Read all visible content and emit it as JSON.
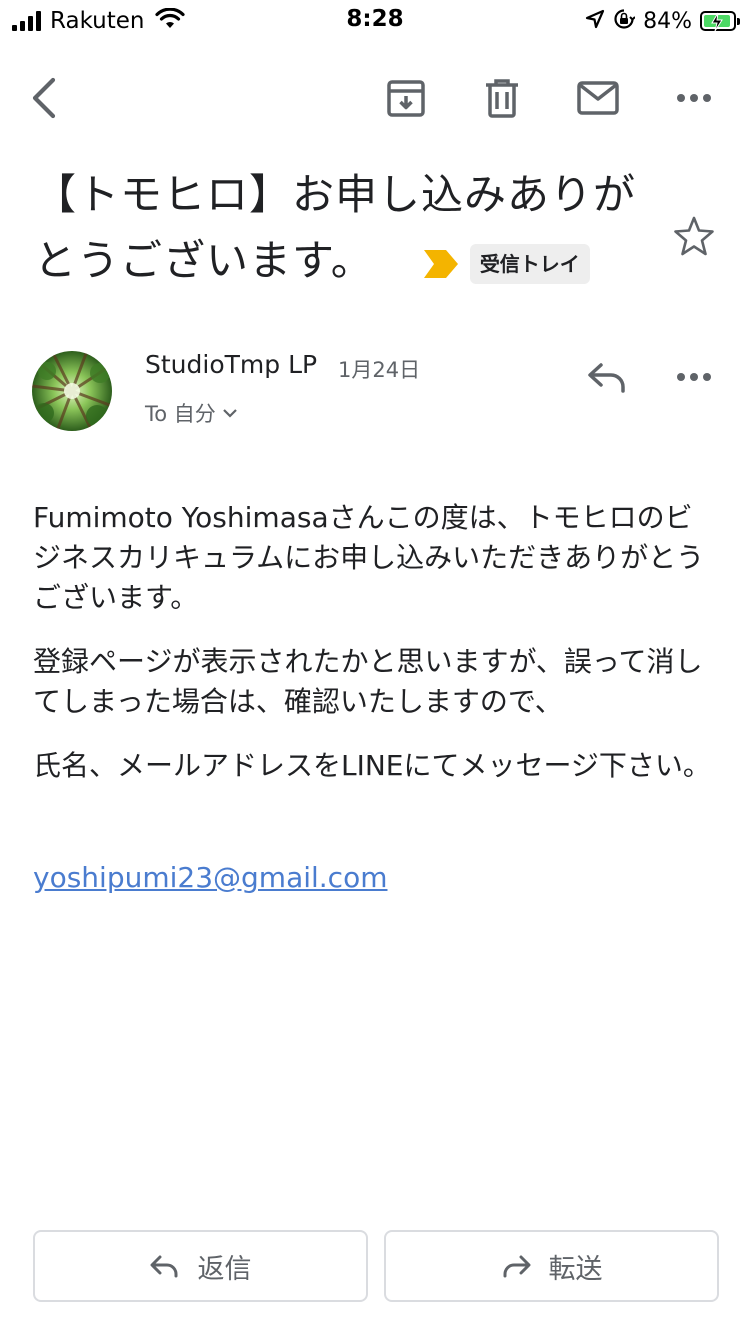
{
  "status_bar": {
    "carrier": "Rakuten",
    "time": "8:28",
    "battery_percent": "84%"
  },
  "toolbar": {
    "back_icon": "chevron-left-icon",
    "archive_icon": "archive-icon",
    "delete_icon": "trash-icon",
    "mark_unread_icon": "mail-icon",
    "more_icon": "more-horiz-icon"
  },
  "email": {
    "subject": "【トモヒロ】お申し込みありがとうございます。",
    "label": "受信トレイ",
    "label_color": "#f4b400",
    "sender": "StudioTmp LP",
    "date": "1月24日",
    "to_line": "To 自分",
    "body": [
      "Fumimoto Yoshimasaさんこの度は、トモヒロのビジネスカリキュラムにお申し込みいただきありがとうございます。",
      "登録ページが表示されたかと思いますが、誤って消してしまった場合は、確認いたしますので、",
      "氏名、メールアドレスをLINEにてメッセージ下さい。"
    ],
    "link": "yoshipumi23@gmail.com"
  },
  "actions": {
    "reply_label": "返信",
    "forward_label": "転送"
  },
  "colors": {
    "link": "#4a7ccf",
    "label_chip_bg": "#eeeeee",
    "battery_fill": "#4cd964"
  }
}
